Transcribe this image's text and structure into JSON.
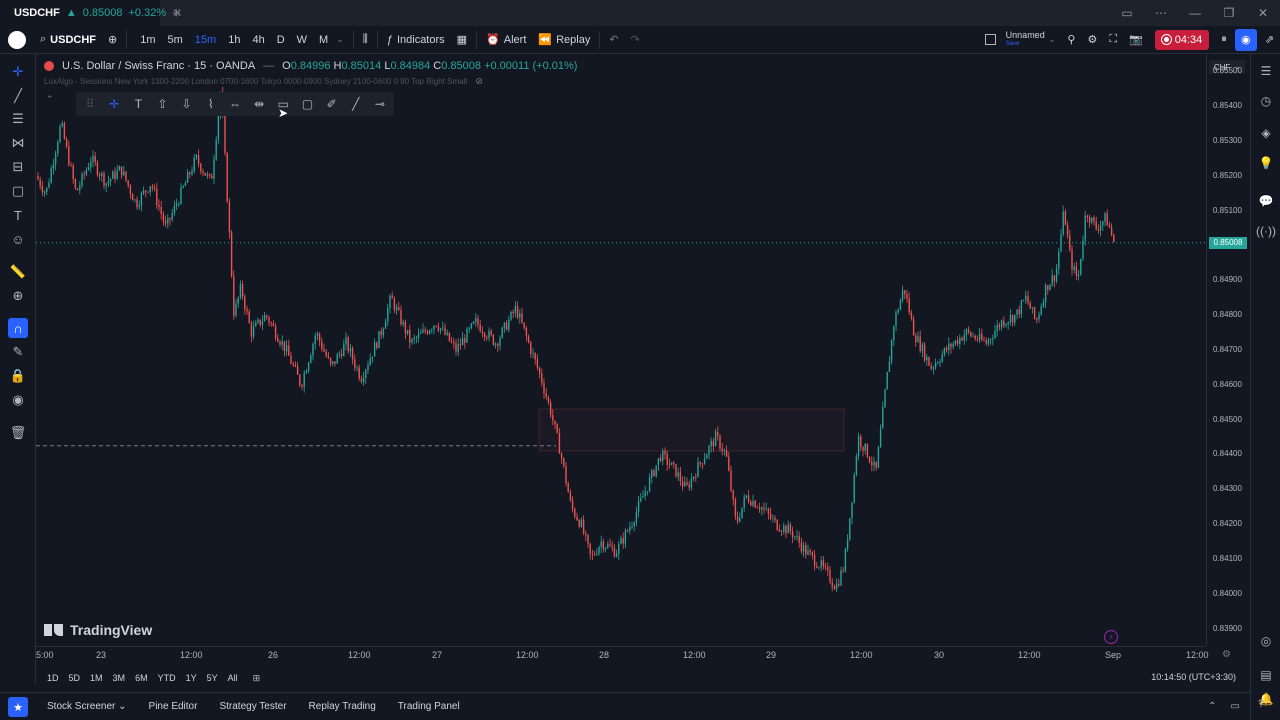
{
  "titlebar": {
    "symbol": "USDCHF",
    "price": "0.85008",
    "change": "+0.32%"
  },
  "header": {
    "symbol": "USDCHF",
    "timeframes": [
      "1m",
      "5m",
      "15m",
      "1h",
      "4h",
      "D",
      "W",
      "M"
    ],
    "active_timeframe": "15m",
    "indicators_label": "Indicators",
    "alert_label": "Alert",
    "replay_label": "Replay",
    "layout_name": "Unnamed",
    "layout_sub": "Save",
    "timer": "04:34"
  },
  "legend": {
    "title": "U.S. Dollar / Swiss Franc · 15 · OANDA",
    "open_key": "O",
    "open": "0.84996",
    "high_key": "H",
    "high": "0.85014",
    "low_key": "L",
    "low": "0.84984",
    "close_key": "C",
    "close": "0.85008",
    "change": "+0.00011 (+0.01%)",
    "indicator": "LuxAlgo - Sessions New York 1300-2200 London 0700-1600 Tokyo 0000-0900 Sydney 2100-0600 0 90 Top Right Small"
  },
  "price_scale": {
    "currency": "CHF",
    "labels": [
      "0.85500",
      "0.85400",
      "0.85300",
      "0.85200",
      "0.85100",
      "0.84900",
      "0.84800",
      "0.84700",
      "0.84600",
      "0.84500",
      "0.84400",
      "0.84300",
      "0.84200",
      "0.84100",
      "0.84000",
      "0.83900"
    ],
    "current_price": "0.85008"
  },
  "time_axis": {
    "labels": [
      "5:00",
      "23",
      "12:00",
      "26",
      "12:00",
      "27",
      "12:00",
      "28",
      "12:00",
      "29",
      "12:00",
      "30",
      "12:00",
      "Sep",
      "12:00"
    ]
  },
  "range_bar": {
    "ranges": [
      "1D",
      "5D",
      "1M",
      "3M",
      "6M",
      "YTD",
      "1Y",
      "5Y",
      "All"
    ],
    "clock": "10:14:50 (UTC+3:30)"
  },
  "bottom_panel": {
    "tabs": [
      "Stock Screener",
      "Pine Editor",
      "Strategy Tester",
      "Replay Trading",
      "Trading Panel"
    ]
  },
  "brand": "TradingView",
  "colors": {
    "background": "#131722",
    "up": "#26a69a",
    "down": "#ef5350",
    "accent": "#2962ff"
  },
  "chart_data": {
    "type": "candlestick",
    "y_range": [
      0.8385,
      0.8555
    ],
    "current_price": 0.85008,
    "horizontal_dashed_level": 0.84425,
    "path": [
      [
        0,
        0.852
      ],
      [
        10,
        0.8515
      ],
      [
        25,
        0.8535
      ],
      [
        40,
        0.8515
      ],
      [
        55,
        0.8525
      ],
      [
        70,
        0.8518
      ],
      [
        85,
        0.8522
      ],
      [
        100,
        0.8512
      ],
      [
        115,
        0.8518
      ],
      [
        130,
        0.8505
      ],
      [
        145,
        0.8515
      ],
      [
        160,
        0.8525
      ],
      [
        175,
        0.8518
      ],
      [
        185,
        0.8545
      ],
      [
        192,
        0.851
      ],
      [
        198,
        0.848
      ],
      [
        205,
        0.8488
      ],
      [
        215,
        0.8475
      ],
      [
        230,
        0.848
      ],
      [
        250,
        0.847
      ],
      [
        265,
        0.846
      ],
      [
        280,
        0.8475
      ],
      [
        295,
        0.8465
      ],
      [
        310,
        0.8472
      ],
      [
        325,
        0.8462
      ],
      [
        345,
        0.8475
      ],
      [
        355,
        0.8485
      ],
      [
        375,
        0.8472
      ],
      [
        400,
        0.8478
      ],
      [
        420,
        0.847
      ],
      [
        440,
        0.8478
      ],
      [
        460,
        0.8472
      ],
      [
        480,
        0.8482
      ],
      [
        495,
        0.847
      ],
      [
        505,
        0.8462
      ],
      [
        515,
        0.8452
      ],
      [
        525,
        0.844
      ],
      [
        535,
        0.8425
      ],
      [
        545,
        0.842
      ],
      [
        555,
        0.841
      ],
      [
        565,
        0.8415
      ],
      [
        580,
        0.8412
      ],
      [
        595,
        0.842
      ],
      [
        610,
        0.843
      ],
      [
        625,
        0.844
      ],
      [
        640,
        0.8435
      ],
      [
        650,
        0.843
      ],
      [
        665,
        0.8438
      ],
      [
        680,
        0.8445
      ],
      [
        690,
        0.844
      ],
      [
        700,
        0.842
      ],
      [
        710,
        0.8428
      ],
      [
        725,
        0.8425
      ],
      [
        740,
        0.842
      ],
      [
        755,
        0.8418
      ],
      [
        770,
        0.8412
      ],
      [
        785,
        0.8408
      ],
      [
        800,
        0.8402
      ],
      [
        808,
        0.8408
      ],
      [
        815,
        0.8425
      ],
      [
        822,
        0.8445
      ],
      [
        832,
        0.844
      ],
      [
        840,
        0.8435
      ],
      [
        850,
        0.846
      ],
      [
        858,
        0.8478
      ],
      [
        868,
        0.8488
      ],
      [
        878,
        0.8475
      ],
      [
        895,
        0.8465
      ],
      [
        910,
        0.847
      ],
      [
        930,
        0.8475
      ],
      [
        950,
        0.8472
      ],
      [
        965,
        0.8478
      ],
      [
        980,
        0.848
      ],
      [
        990,
        0.8485
      ],
      [
        1000,
        0.8478
      ],
      [
        1010,
        0.8488
      ],
      [
        1020,
        0.8492
      ],
      [
        1028,
        0.851
      ],
      [
        1035,
        0.8495
      ],
      [
        1042,
        0.849
      ],
      [
        1050,
        0.851
      ],
      [
        1060,
        0.8505
      ],
      [
        1070,
        0.8508
      ],
      [
        1078,
        0.8501
      ]
    ]
  }
}
